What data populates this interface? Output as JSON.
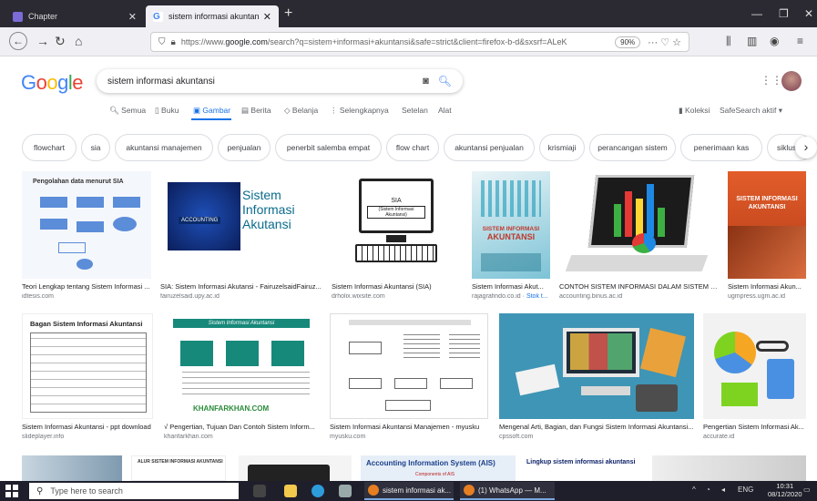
{
  "browser": {
    "tabs": [
      {
        "label": "Chapter",
        "close": "✕"
      },
      {
        "label": "sistem informasi akuntansi - G",
        "close": "✕"
      }
    ],
    "new_tab": "+",
    "url_prefix": "https://www.",
    "url_host": "google.com",
    "url_rest": "/search?q=sistem+informasi+akuntansi&safe=strict&client=firefox-b-d&sxsrf=ALeK",
    "zoom": "90%",
    "url_tail": "··· ♡ ☆"
  },
  "google": {
    "logo": [
      "G",
      "o",
      "o",
      "g",
      "l",
      "e"
    ],
    "query": "sistem informasi akuntansi"
  },
  "search_nav": {
    "items": [
      {
        "label": "Semua",
        "active": false
      },
      {
        "label": "Buku",
        "active": false
      },
      {
        "label": "Gambar",
        "active": true
      },
      {
        "label": "Berita",
        "active": false
      },
      {
        "label": "Belanja",
        "active": false
      },
      {
        "label": "Selengkapnya",
        "active": false
      },
      {
        "label": "Setelan",
        "active": false
      },
      {
        "label": "Alat",
        "active": false
      }
    ],
    "collections": "Koleksi",
    "safesearch": "SafeSearch aktif"
  },
  "chips": [
    "flowchart",
    "sia",
    "akuntansi manajemen",
    "penjualan",
    "penerbit salemba empat",
    "flow chart",
    "akuntansi penjualan",
    "krismiaji",
    "perancangan sistem",
    "penerimaan kas",
    "siklus"
  ],
  "results_row1": [
    {
      "title": "Teori Lengkap tentang Sistem Informasi ...",
      "source": "idtesis.com",
      "caption": "Pengolahan data menurut SIA"
    },
    {
      "title": "SIA: Sistem Informasi Akutansi - FairuzelsaidFairuz...",
      "source": "fairuzelsaid.upy.ac.id",
      "caption_lines": [
        "Sistem",
        "Informasi",
        "Akutansi"
      ],
      "badge": "ACCOUNTING"
    },
    {
      "title": "Sistem Informasi Akuntansi (SIA)",
      "source": "drholix.wixsite.com",
      "caption_lines": [
        "SIA",
        "(Sistem Informasi Akuntansi)"
      ]
    },
    {
      "title": "Sistem Informasi Akut...",
      "source": "rajagrafindo.co.id",
      "tag": "Stok t...",
      "caption_lines": [
        "SISTEM INFORMASI",
        "AKUNTANSI"
      ]
    },
    {
      "title": "CONTOH SISTEM INFORMASI DALAM SISTEM INF...",
      "source": "accounting.binus.ac.id"
    },
    {
      "title": "Sistem Informasi Akun...",
      "source": "ugmpress.ugm.ac.id",
      "caption_lines": [
        "SISTEM INFORMASI",
        "AKUNTANSI"
      ]
    }
  ],
  "results_row2": [
    {
      "title": "Sistem Informasi Akuntansi - ppt download",
      "source": "slideplayer.info",
      "caption": "Bagan Sistem Informasi Akuntansi"
    },
    {
      "title": "√ Pengertian, Tujuan Dan Contoh Sistem Inform...",
      "source": "khanfarkhan.com",
      "caption": "Sistem Informasi Akuntansi",
      "footer": "KHANFARKHAN.COM"
    },
    {
      "title": "Sistem Informasi Akuntansi Manajemen - myusku",
      "source": "myusku.com"
    },
    {
      "title": "Mengenal Arti, Bagian, dan Fungsi Sistem Informasi Akuntansi...",
      "source": "cpssoft.com"
    },
    {
      "title": "Pengertian Sistem Informasi Ak...",
      "source": "accurate.id"
    }
  ],
  "results_row3": [
    {
      "caption": "ALUR SISTEM INFORMASI AKUNTANSI"
    },
    {
      "caption": "Accounting Information System (AIS)",
      "sub": "Components of AIS"
    },
    {
      "caption": "Lingkup sistem informasi akuntansi"
    }
  ],
  "taskbar": {
    "search_placeholder": "Type here to search",
    "apps": [
      "sistem informasi ak...",
      "(1) WhatsApp — M..."
    ],
    "lang": "ENG",
    "time": "10:31",
    "date": "08/12/2020"
  },
  "colors": {
    "accent": "#1a73e8",
    "tabbar": "#2b2a33",
    "taskbar": "#1f1f2b"
  }
}
